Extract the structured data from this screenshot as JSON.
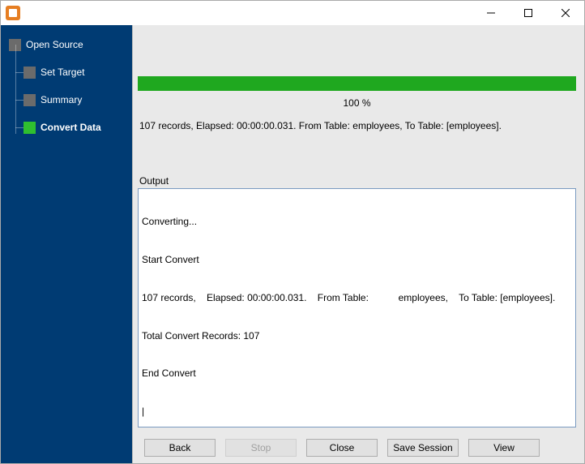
{
  "nav": {
    "root": "Open Source",
    "items": [
      {
        "label": "Set Target"
      },
      {
        "label": "Summary"
      },
      {
        "label": "Convert Data",
        "active": true
      }
    ]
  },
  "progress": {
    "percent_text": "100 %"
  },
  "status_line": "107 records,     Elapsed: 00:00:00.031.     From Table:           employees,     To Table: [employees].",
  "output": {
    "label": "Output",
    "lines": [
      "Converting...",
      "Start Convert",
      "107 records,    Elapsed: 00:00:00.031.    From Table:           employees,    To Table: [employees].",
      "Total Convert Records: 107",
      "End Convert"
    ]
  },
  "buttons": {
    "back": "Back",
    "stop": "Stop",
    "close": "Close",
    "save_session": "Save Session",
    "view": "View"
  }
}
